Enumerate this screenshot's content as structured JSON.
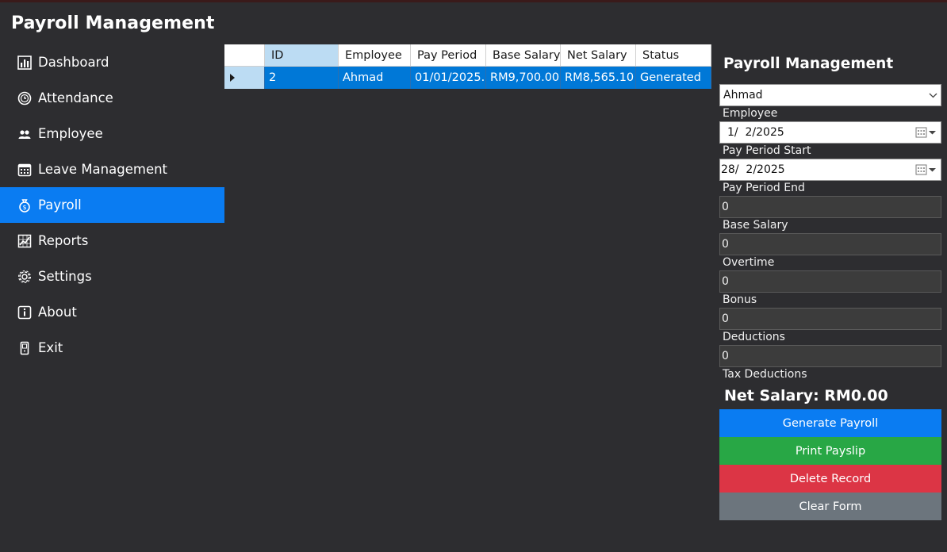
{
  "app": {
    "title": "Payroll Management"
  },
  "sidebar": {
    "items": [
      {
        "label": "Dashboard",
        "icon": "chart-icon"
      },
      {
        "label": "Attendance",
        "icon": "clock-icon"
      },
      {
        "label": "Employee",
        "icon": "users-icon"
      },
      {
        "label": "Leave Management",
        "icon": "calendar-icon"
      },
      {
        "label": "Payroll",
        "icon": "money-bag-icon",
        "active": true
      },
      {
        "label": "Reports",
        "icon": "report-chart-icon"
      },
      {
        "label": "Settings",
        "icon": "gear-icon"
      },
      {
        "label": "About",
        "icon": "info-icon"
      },
      {
        "label": "Exit",
        "icon": "door-icon"
      }
    ]
  },
  "grid": {
    "columns": [
      "ID",
      "Employee",
      "Pay Period",
      "Base Salary",
      "Net Salary",
      "Status"
    ],
    "rows": [
      {
        "id": "2",
        "employee": "Ahmad",
        "pay_period": "01/01/2025...",
        "base_salary": "RM9,700.00",
        "net_salary": "RM8,565.10",
        "status": "Generated"
      }
    ]
  },
  "form": {
    "title": "Payroll Management",
    "employee_select": "Ahmad",
    "employee_label": "Employee",
    "pay_period_start_value": "1/  2/2025",
    "pay_period_start_label": "Pay Period Start",
    "pay_period_end_value": "28/  2/2025",
    "pay_period_end_label": "Pay Period End",
    "base_salary_value": "0",
    "base_salary_label": "Base Salary",
    "overtime_value": "0",
    "overtime_label": "Overtime",
    "bonus_value": "0",
    "bonus_label": "Bonus",
    "deductions_value": "0",
    "deductions_label": "Deductions",
    "tax_deductions_value": "0",
    "tax_deductions_label": "Tax Deductions",
    "net_salary": "Net Salary: RM0.00"
  },
  "buttons": {
    "generate": "Generate Payroll",
    "print": "Print Payslip",
    "delete": "Delete Record",
    "clear": "Clear Form"
  },
  "colors": {
    "background": "#2d2d30",
    "accent": "#0a7cf2",
    "selected_row": "#0078d7",
    "green": "#28a745",
    "red": "#dc3545",
    "gray": "#6c757d"
  }
}
